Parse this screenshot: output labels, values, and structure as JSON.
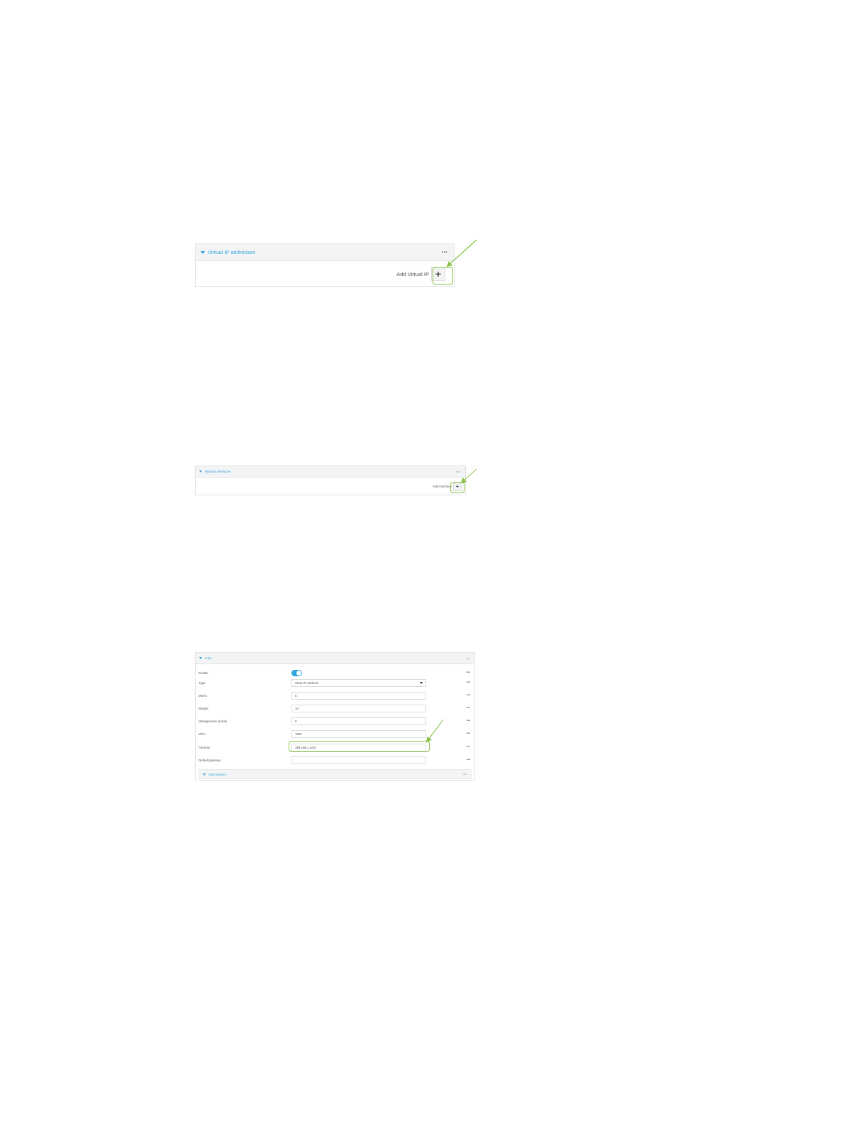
{
  "panel1": {
    "title": "Virtual IP addresses",
    "menu": "•••",
    "add_label": "Add Virtual IP",
    "add_button": "+"
  },
  "panel2": {
    "title": "Monitor interfaces",
    "menu": "•••",
    "add_label": "Add interface",
    "add_button": "+"
  },
  "panel3": {
    "title": "vrrp1",
    "menu": "•••",
    "rows": {
      "enable": {
        "label": "Enable",
        "value": true
      },
      "type": {
        "label": "Type",
        "value": "Static IP address"
      },
      "metric": {
        "label": "Metric",
        "value": "5"
      },
      "weight": {
        "label": "Weight",
        "value": "10"
      },
      "management_priority": {
        "label": "Management priority",
        "value": "0"
      },
      "mtu": {
        "label": "MTU",
        "value": "1500"
      },
      "address": {
        "label": "Address",
        "value": "192.168.1.1/24"
      },
      "default_gateway": {
        "label": "Default gateway",
        "value": ""
      }
    },
    "row_menu": "•••",
    "dns_title": "DNS servers",
    "dns_menu": "•••"
  },
  "colors": {
    "accent": "#2fa3db",
    "highlight": "#8bc34a",
    "header_bg": "#f3f4f5"
  }
}
